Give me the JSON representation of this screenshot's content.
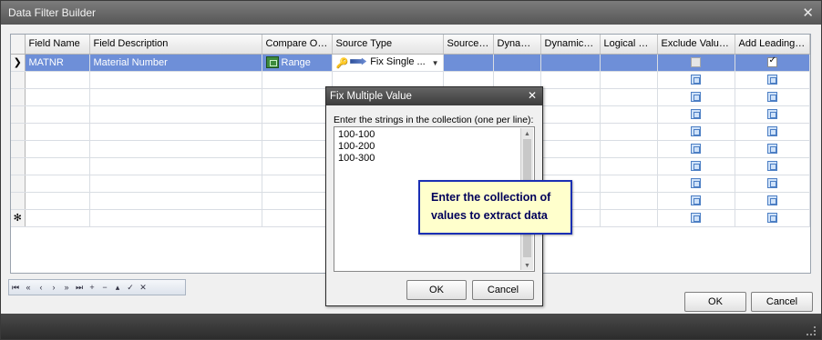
{
  "window": {
    "title": "Data Filter Builder",
    "close_glyph": "✕"
  },
  "grid": {
    "columns": [
      "Field Name",
      "Field Description",
      "Compare Op...",
      "Source Type",
      "Source ...",
      "Dynami...",
      "Dynamic F...",
      "Logical O...",
      "Exclude Value ...",
      "Add Leading ..."
    ],
    "selected_row": {
      "field_name": "MATNR",
      "field_description": "Material Number",
      "compare_operator": "Range",
      "source_type": "Fix Single ...",
      "exclude_value": false,
      "add_leading": true
    },
    "empty_row_count": 9,
    "new_row_glyph": "✻",
    "current_row_glyph": "❯"
  },
  "navigator": {
    "buttons": [
      "⏮",
      "«",
      "‹",
      "›",
      "»",
      "⏭",
      "+",
      "−",
      "▴",
      "✓",
      "✕"
    ]
  },
  "footer": {
    "ok_label": "OK",
    "cancel_label": "Cancel"
  },
  "dialog": {
    "title": "Fix Multiple Value",
    "prompt": "Enter the strings in the collection (one per line):",
    "lines": [
      "100-100",
      "100-200",
      "100-300"
    ],
    "ok_label": "OK",
    "cancel_label": "Cancel"
  },
  "callout": {
    "text": "Enter the collection of values to extract data"
  }
}
